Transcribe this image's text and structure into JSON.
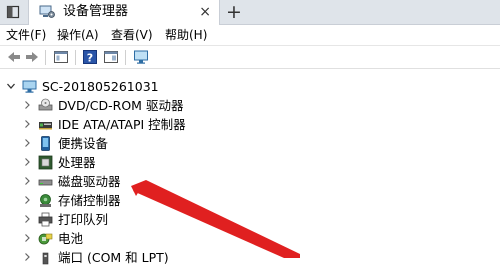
{
  "window": {
    "tab_title": "设备管理器",
    "close_glyph": "×",
    "new_tab_glyph": "+"
  },
  "menubar": {
    "items": [
      "文件(F)",
      "操作(A)",
      "查看(V)",
      "帮助(H)"
    ]
  },
  "toolbar": {
    "buttons": [
      "back-icon",
      "forward-icon",
      "properties-panel-icon",
      "help-icon",
      "console-view-icon",
      "monitor-icon"
    ]
  },
  "tree": {
    "root": {
      "label": "SC-201805261031",
      "expanded": true,
      "icon": "computer-icon"
    },
    "children": [
      {
        "label": "DVD/CD-ROM 驱动器",
        "icon": "dvd-drive-icon"
      },
      {
        "label": "IDE ATA/ATAPI 控制器",
        "icon": "ide-controller-icon"
      },
      {
        "label": "便携设备",
        "icon": "portable-device-icon"
      },
      {
        "label": "处理器",
        "icon": "processor-icon"
      },
      {
        "label": "磁盘驱动器",
        "icon": "disk-drive-icon"
      },
      {
        "label": "存储控制器",
        "icon": "storage-controller-icon"
      },
      {
        "label": "打印队列",
        "icon": "printer-icon"
      },
      {
        "label": "电池",
        "icon": "battery-icon"
      },
      {
        "label": "端口 (COM 和 LPT)",
        "icon": "port-icon"
      }
    ]
  },
  "annotation": {
    "color": "#e02020"
  }
}
